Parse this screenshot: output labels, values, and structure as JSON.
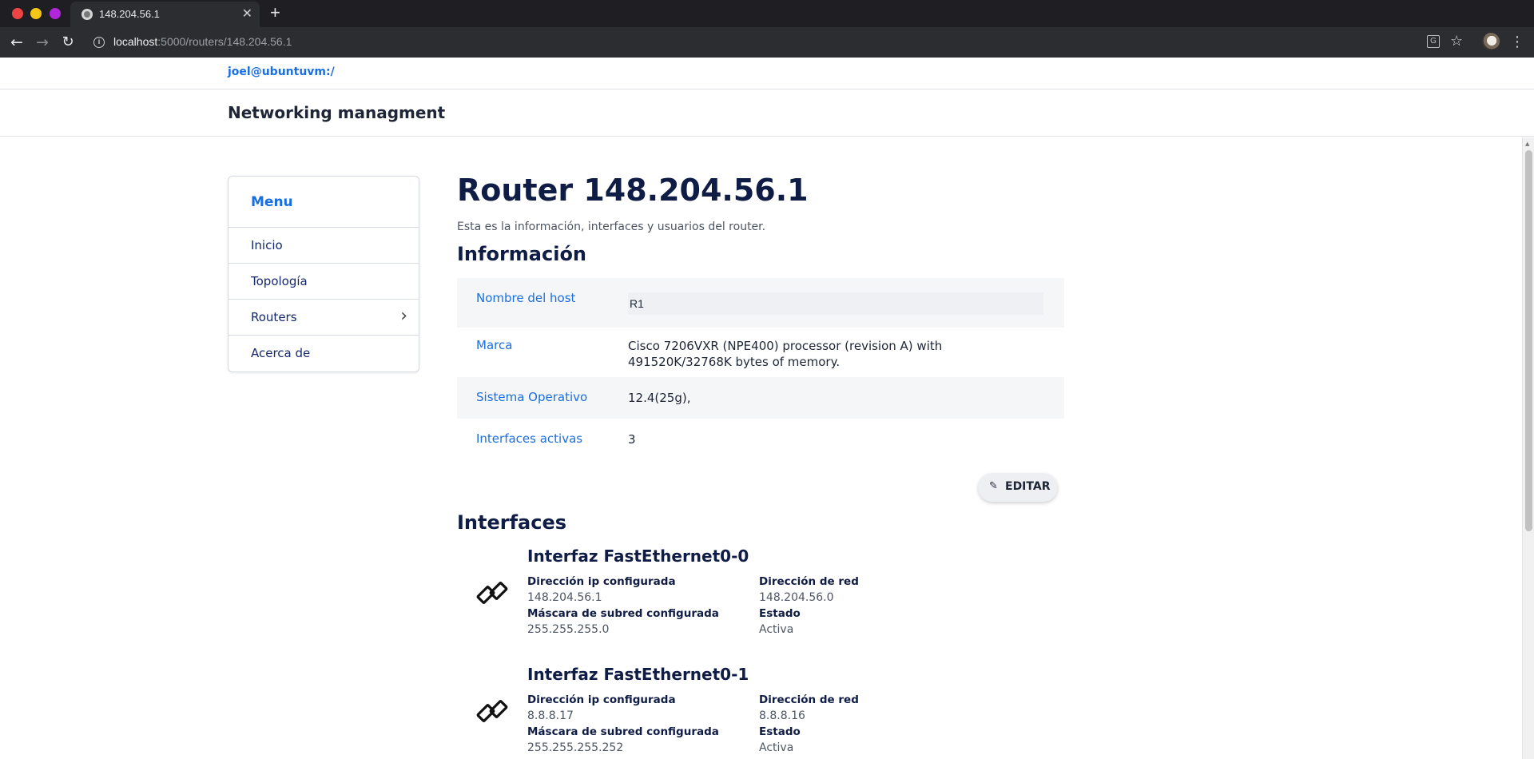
{
  "browser": {
    "tab_title": "148.204.56.1",
    "url_host": "localhost",
    "url_path": ":5000/routers/148.204.56.1"
  },
  "page": {
    "user_link": "joel@ubuntuvm:/",
    "app_title": "Networking managment"
  },
  "sidebar": {
    "title": "Menu",
    "items": [
      {
        "label": "Inicio"
      },
      {
        "label": "Topología"
      },
      {
        "label": "Routers"
      },
      {
        "label": "Acerca de"
      }
    ]
  },
  "main": {
    "title": "Router 148.204.56.1",
    "subtitle": "Esta es la información, interfaces y usuarios del router.",
    "info_heading": "Información",
    "info": {
      "hostname_label": "Nombre del host",
      "hostname_value": "R1",
      "brand_label": "Marca",
      "brand_value": "Cisco 7206VXR (NPE400) processor (revision A) with 491520K/32768K bytes of memory.",
      "os_label": "Sistema Operativo",
      "os_value": "12.4(25g),",
      "active_label": "Interfaces activas",
      "active_value": "3"
    },
    "edit_label": "EDITAR",
    "interfaces_heading": "Interfaces",
    "interfaces": [
      {
        "title": "Interfaz FastEthernet0-0",
        "ip_label": "Dirección ip configurada",
        "ip": "148.204.56.1",
        "mask_label": "Máscara de subred configurada",
        "mask": "255.255.255.0",
        "net_label": "Dirección de red",
        "net": "148.204.56.0",
        "state_label": "Estado",
        "state": "Activa"
      },
      {
        "title": "Interfaz FastEthernet0-1",
        "ip_label": "Dirección ip configurada",
        "ip": "8.8.8.17",
        "mask_label": "Máscara de subred configurada",
        "mask": "255.255.255.252",
        "net_label": "Dirección de red",
        "net": "8.8.8.16",
        "state_label": "Estado",
        "state": "Activa"
      }
    ]
  },
  "colors": {
    "accent": "#1a6fe0",
    "heading": "#0f1c45"
  }
}
